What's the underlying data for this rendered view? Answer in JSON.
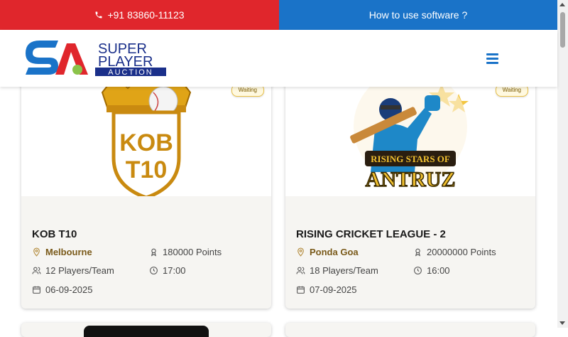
{
  "topbar": {
    "phone": "+91 83860-11123",
    "howto": "How to use software ?"
  },
  "colors": {
    "red": "#e0262c",
    "blue": "#1a73c8",
    "badge_text": "#7a5a00",
    "location": "#7a5a1a"
  },
  "logo": {
    "line1": "SUPER",
    "line2": "PLAYER",
    "line3": "AUCTION",
    "mark": "SPA"
  },
  "cards": [
    {
      "title": "KOB T10",
      "status": "Waiting",
      "location": "Melbourne",
      "points": "180000 Points",
      "players": "12 Players/Team",
      "time": "17:00",
      "date": "06-09-2025",
      "image_text": "KOB T10"
    },
    {
      "title": "RISING CRICKET LEAGUE - 2",
      "status": "Waiting",
      "location": "Ponda Goa",
      "points": "20000000 Points",
      "players": "18 Players/Team",
      "time": "16:00",
      "date": "07-09-2025",
      "image_text_1": "RISING STARS OF",
      "image_text_2": "ANTRUZ"
    }
  ],
  "icons": {
    "phone": "phone-icon",
    "menu": "hamburger-menu-icon",
    "location": "location-pin-icon",
    "points": "award-icon",
    "players": "users-icon",
    "time": "clock-icon",
    "date": "calendar-icon"
  }
}
